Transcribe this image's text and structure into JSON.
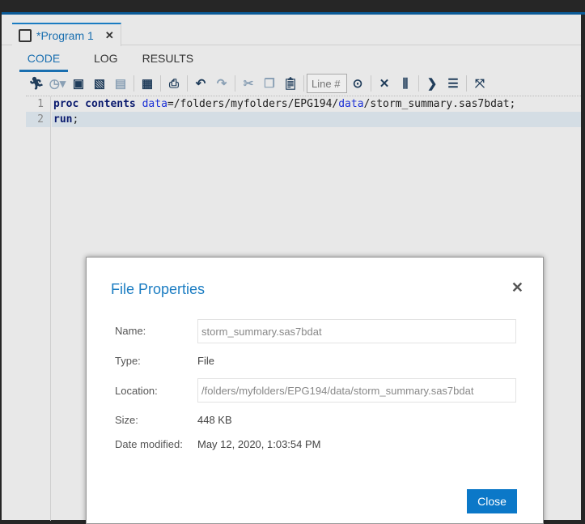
{
  "tab": {
    "title": "*Program 1",
    "close": "✕"
  },
  "subtabs": [
    "CODE",
    "LOG",
    "RESULTS"
  ],
  "toolbar": {
    "line_placeholder": "Line #"
  },
  "editor": {
    "line_numbers": [
      "1",
      "2"
    ],
    "line1": {
      "kw1": "proc",
      "sp1": " ",
      "kw2": "contents",
      "sp2": " ",
      "opt": "data",
      "p1": "=/folders/myfolders/EPG194/",
      "d2": "data",
      "p2": "/storm_summary.sas7bdat;"
    },
    "line2": {
      "kw": "run",
      ";": ";"
    }
  },
  "dialog": {
    "title": "File Properties",
    "close_icon": "✕",
    "name_label": "Name:",
    "name_value": "storm_summary.sas7bdat",
    "type_label": "Type:",
    "type_value": "File",
    "location_label": "Location:",
    "location_value": "/folders/myfolders/EPG194/data/storm_summary.sas7bdat",
    "size_label": "Size:",
    "size_value": "448 KB",
    "date_label": "Date modified:",
    "date_value": "May 12, 2020, 1:03:54 PM",
    "close_button": "Close"
  }
}
